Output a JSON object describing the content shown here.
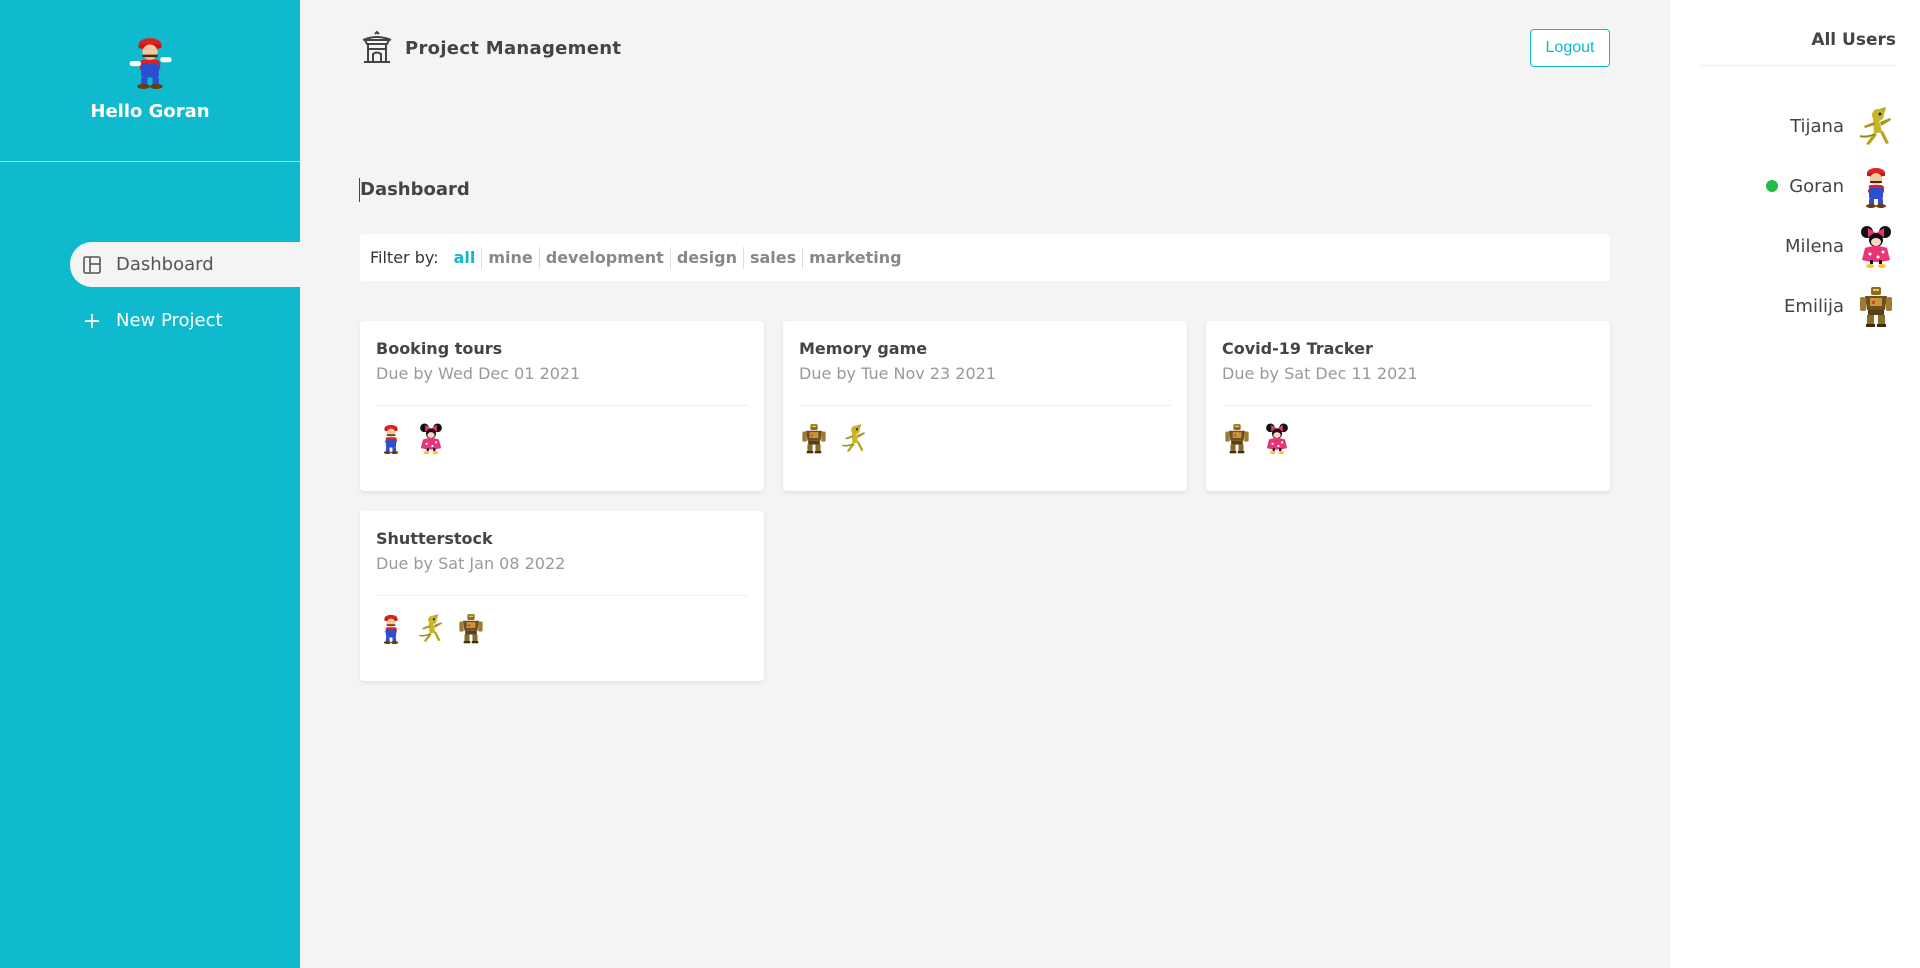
{
  "sidebar": {
    "greeting": "Hello Goran",
    "avatar": "mario-avatar",
    "nav": [
      {
        "label": "Dashboard",
        "icon": "dashboard-icon",
        "active": true
      },
      {
        "label": "New Project",
        "icon": "plus-icon",
        "active": false
      }
    ]
  },
  "header": {
    "title": "Project Management",
    "logo": "temple-icon",
    "logout_label": "Logout"
  },
  "main": {
    "page_title": "Dashboard",
    "filter": {
      "label": "Filter by:",
      "options": [
        "all",
        "mine",
        "development",
        "design",
        "sales",
        "marketing"
      ],
      "selected": "all"
    },
    "projects": [
      {
        "title": "Booking tours",
        "due": "Due by Wed Dec 01 2021",
        "members": [
          "mario",
          "minnie"
        ]
      },
      {
        "title": "Memory game",
        "due": "Due by Tue Nov 23 2021",
        "members": [
          "robot",
          "lizard"
        ]
      },
      {
        "title": "Covid-19 Tracker",
        "due": "Due by Sat Dec 11 2021",
        "members": [
          "robot",
          "minnie"
        ]
      },
      {
        "title": "Shutterstock",
        "due": "Due by Sat Jan 08 2022",
        "members": [
          "mario",
          "lizard",
          "robot"
        ]
      }
    ]
  },
  "users_panel": {
    "title": "All Users",
    "users": [
      {
        "name": "Tijana",
        "avatar": "lizard",
        "online": false
      },
      {
        "name": "Goran",
        "avatar": "mario",
        "online": true
      },
      {
        "name": "Milena",
        "avatar": "minnie",
        "online": false
      },
      {
        "name": "Emilija",
        "avatar": "robot",
        "online": false
      }
    ]
  },
  "colors": {
    "accent": "#0fbacf",
    "online": "#22bb44",
    "background": "#f4f4f4"
  }
}
